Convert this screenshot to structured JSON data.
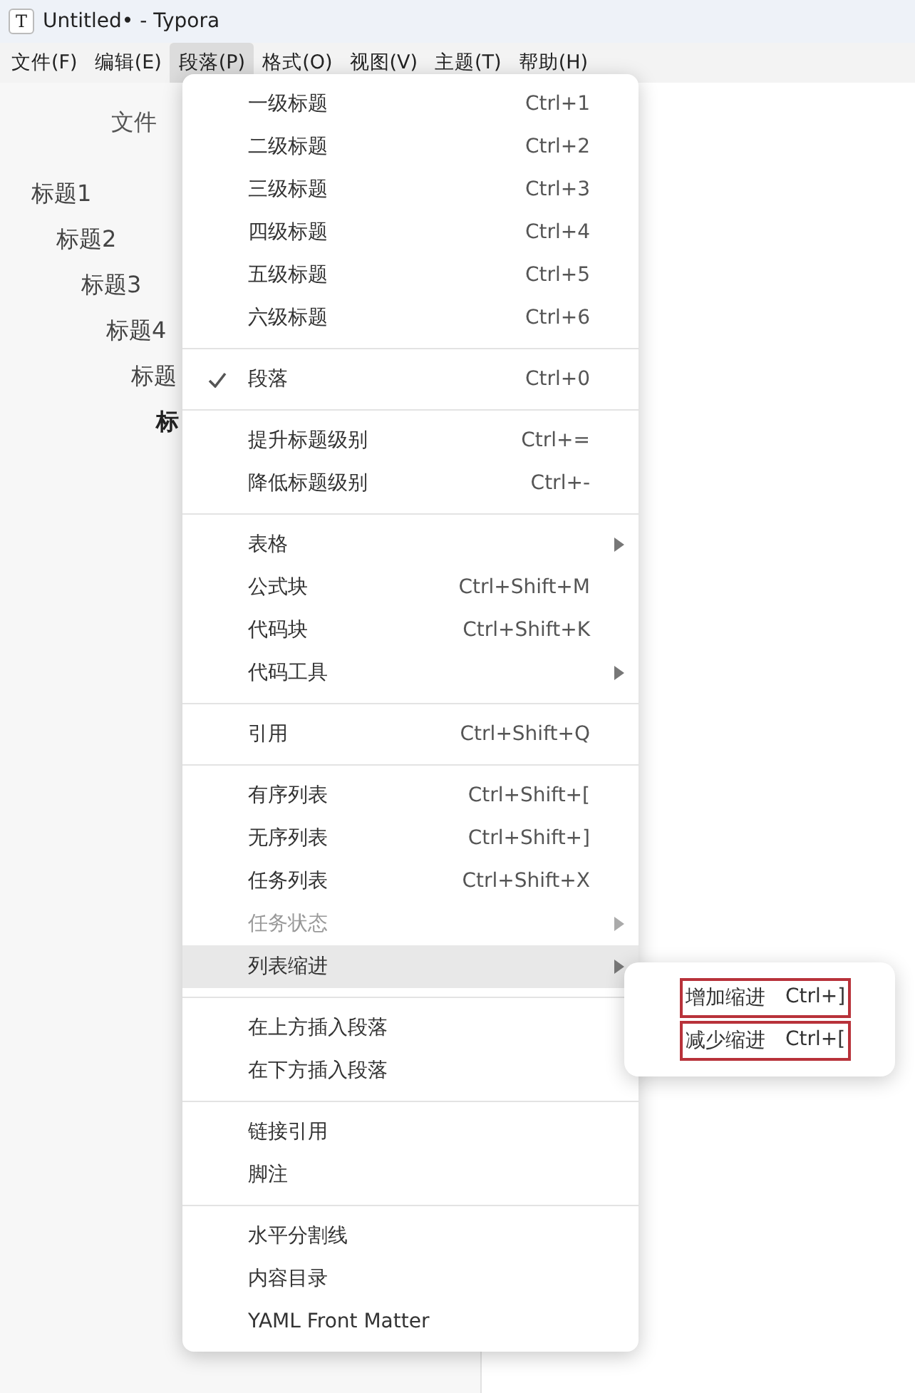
{
  "window": {
    "app_icon": "T",
    "title": "Untitled• - Typora"
  },
  "menubar": [
    {
      "label": "文件(F)",
      "selected": false
    },
    {
      "label": "编辑(E)",
      "selected": false
    },
    {
      "label": "段落(P)",
      "selected": true
    },
    {
      "label": "格式(O)",
      "selected": false
    },
    {
      "label": "视图(V)",
      "selected": false
    },
    {
      "label": "主题(T)",
      "selected": false
    },
    {
      "label": "帮助(H)",
      "selected": false
    }
  ],
  "sidebar": {
    "tab": "文件",
    "outline": [
      {
        "label": "标题1",
        "active": false,
        "children": [
          {
            "label": "标题2",
            "active": false,
            "children": [
              {
                "label": "标题3",
                "active": false,
                "children": [
                  {
                    "label": "标题4",
                    "active": false,
                    "children": [
                      {
                        "label": "标题",
                        "active": false,
                        "children": [
                          {
                            "label": "标",
                            "active": true
                          }
                        ]
                      }
                    ]
                  }
                ]
              }
            ]
          }
        ]
      }
    ]
  },
  "menu": {
    "groups": [
      [
        {
          "label": "一级标题",
          "shortcut": "Ctrl+1",
          "checked": false,
          "disabled": false,
          "highlighted": false,
          "has_submenu": false
        },
        {
          "label": "二级标题",
          "shortcut": "Ctrl+2",
          "checked": false,
          "disabled": false,
          "highlighted": false,
          "has_submenu": false
        },
        {
          "label": "三级标题",
          "shortcut": "Ctrl+3",
          "checked": false,
          "disabled": false,
          "highlighted": false,
          "has_submenu": false
        },
        {
          "label": "四级标题",
          "shortcut": "Ctrl+4",
          "checked": false,
          "disabled": false,
          "highlighted": false,
          "has_submenu": false
        },
        {
          "label": "五级标题",
          "shortcut": "Ctrl+5",
          "checked": false,
          "disabled": false,
          "highlighted": false,
          "has_submenu": false
        },
        {
          "label": "六级标题",
          "shortcut": "Ctrl+6",
          "checked": false,
          "disabled": false,
          "highlighted": false,
          "has_submenu": false
        }
      ],
      [
        {
          "label": "段落",
          "shortcut": "Ctrl+0",
          "checked": true,
          "disabled": false,
          "highlighted": false,
          "has_submenu": false
        }
      ],
      [
        {
          "label": "提升标题级别",
          "shortcut": "Ctrl+=",
          "checked": false,
          "disabled": false,
          "highlighted": false,
          "has_submenu": false
        },
        {
          "label": "降低标题级别",
          "shortcut": "Ctrl+-",
          "checked": false,
          "disabled": false,
          "highlighted": false,
          "has_submenu": false
        }
      ],
      [
        {
          "label": "表格",
          "checked": false,
          "disabled": false,
          "highlighted": false,
          "has_submenu": true
        },
        {
          "label": "公式块",
          "shortcut": "Ctrl+Shift+M",
          "checked": false,
          "disabled": false,
          "highlighted": false,
          "has_submenu": false
        },
        {
          "label": "代码块",
          "shortcut": "Ctrl+Shift+K",
          "checked": false,
          "disabled": false,
          "highlighted": false,
          "has_submenu": false
        },
        {
          "label": "代码工具",
          "checked": false,
          "disabled": false,
          "highlighted": false,
          "has_submenu": true
        }
      ],
      [
        {
          "label": "引用",
          "shortcut": "Ctrl+Shift+Q",
          "checked": false,
          "disabled": false,
          "highlighted": false,
          "has_submenu": false
        }
      ],
      [
        {
          "label": "有序列表",
          "shortcut": "Ctrl+Shift+[",
          "checked": false,
          "disabled": false,
          "highlighted": false,
          "has_submenu": false
        },
        {
          "label": "无序列表",
          "shortcut": "Ctrl+Shift+]",
          "checked": false,
          "disabled": false,
          "highlighted": false,
          "has_submenu": false
        },
        {
          "label": "任务列表",
          "shortcut": "Ctrl+Shift+X",
          "checked": false,
          "disabled": false,
          "highlighted": false,
          "has_submenu": false
        },
        {
          "label": "任务状态",
          "checked": false,
          "disabled": true,
          "highlighted": false,
          "has_submenu": true
        },
        {
          "label": "列表缩进",
          "checked": false,
          "disabled": false,
          "highlighted": true,
          "has_submenu": true
        }
      ],
      [
        {
          "label": "在上方插入段落",
          "checked": false,
          "disabled": false,
          "highlighted": false,
          "has_submenu": false
        },
        {
          "label": "在下方插入段落",
          "checked": false,
          "disabled": false,
          "highlighted": false,
          "has_submenu": false
        }
      ],
      [
        {
          "label": "链接引用",
          "checked": false,
          "disabled": false,
          "highlighted": false,
          "has_submenu": false
        },
        {
          "label": "脚注",
          "checked": false,
          "disabled": false,
          "highlighted": false,
          "has_submenu": false
        }
      ],
      [
        {
          "label": "水平分割线",
          "checked": false,
          "disabled": false,
          "highlighted": false,
          "has_submenu": false
        },
        {
          "label": "内容目录",
          "checked": false,
          "disabled": false,
          "highlighted": false,
          "has_submenu": false
        },
        {
          "label": "YAML Front Matter",
          "checked": false,
          "disabled": false,
          "highlighted": false,
          "has_submenu": false
        }
      ]
    ]
  },
  "submenu": [
    {
      "label": "增加缩进",
      "shortcut": "Ctrl+]",
      "outlined": true
    },
    {
      "label": "减少缩进",
      "shortcut": "Ctrl+[",
      "outlined": true
    }
  ]
}
